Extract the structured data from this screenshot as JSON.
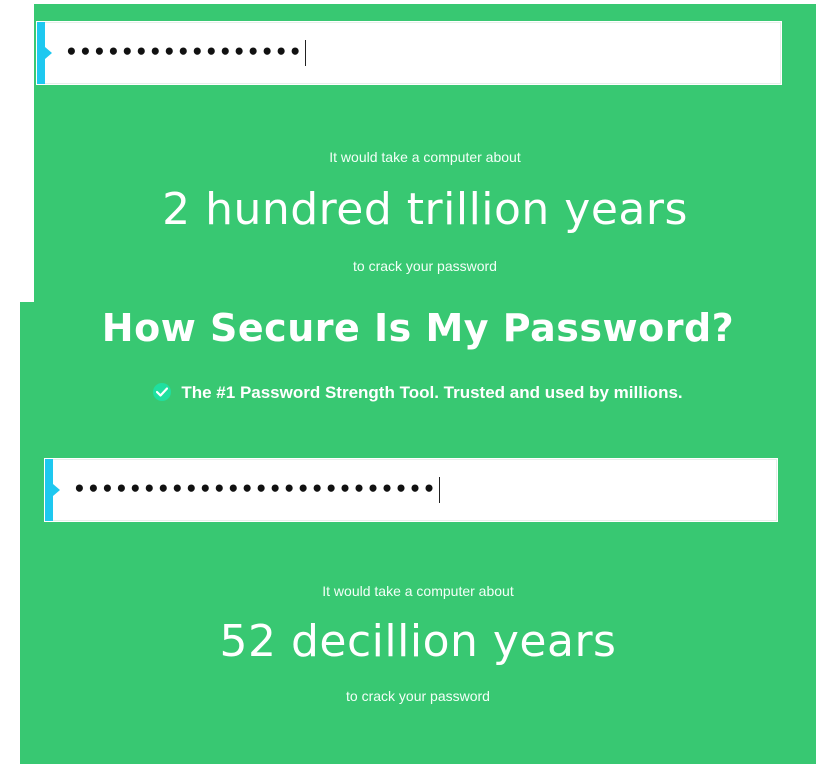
{
  "top_section": {
    "password_masked": "•••••••••••••••••",
    "pre_text": "It would take a computer about",
    "time_result": "2 hundred trillion years",
    "post_text": "to crack your password"
  },
  "header": {
    "title": "How Secure Is My Password?",
    "tagline": "The #1 Password Strength Tool. Trusted and used by millions."
  },
  "bottom_section": {
    "password_masked": "••••••••••••••••••••••••••",
    "pre_text": "It would take a computer about",
    "time_result": "52 decillion years",
    "post_text": "to crack your password"
  },
  "colors": {
    "background": "#38c872",
    "accent": "#1ec8f0",
    "check_icon": "#1fe0a0"
  },
  "icons": {
    "tagline_icon": "check-circle-icon",
    "input_marker": "caret-right-icon"
  }
}
